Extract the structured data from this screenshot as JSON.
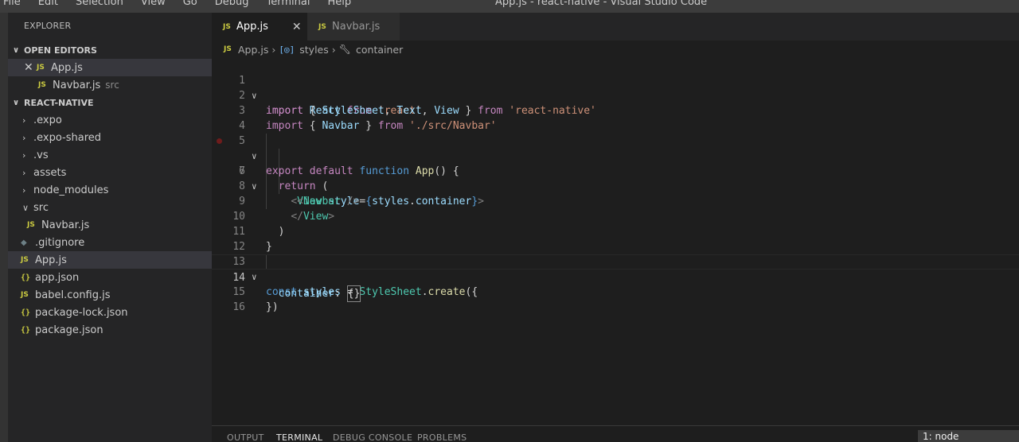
{
  "titlebar": {
    "menu": [
      "File",
      "Edit",
      "Selection",
      "View",
      "Go",
      "Debug",
      "Terminal",
      "Help"
    ],
    "title": "App.js - react-native - Visual Studio Code"
  },
  "sidebar": {
    "title": "EXPLORER",
    "open_editors": {
      "header": "OPEN EDITORS",
      "items": [
        {
          "name": "App.js",
          "badge": "JS"
        },
        {
          "name": "Navbar.js",
          "badge": "JS",
          "path": "src"
        }
      ]
    },
    "project": {
      "header": "REACT-NATIVE",
      "items": [
        {
          "name": ".expo",
          "type": "folder"
        },
        {
          "name": ".expo-shared",
          "type": "folder"
        },
        {
          "name": ".vs",
          "type": "folder"
        },
        {
          "name": "assets",
          "type": "folder"
        },
        {
          "name": "node_modules",
          "type": "folder"
        },
        {
          "name": "src",
          "type": "folder-open"
        },
        {
          "name": "Navbar.js",
          "type": "js"
        },
        {
          "name": ".gitignore",
          "type": "git"
        },
        {
          "name": "App.js",
          "type": "js"
        },
        {
          "name": "app.json",
          "type": "json"
        },
        {
          "name": "babel.config.js",
          "type": "js"
        },
        {
          "name": "package-lock.json",
          "type": "json"
        },
        {
          "name": "package.json",
          "type": "json"
        }
      ]
    },
    "badges": {
      "js": "JS",
      "json": "{}",
      "git": "◆"
    }
  },
  "tabs": [
    {
      "label": "App.js",
      "badge": "JS",
      "active": true
    },
    {
      "label": "Navbar.js",
      "badge": "JS",
      "active": false
    }
  ],
  "breadcrumb": {
    "file": "App.js",
    "file_badge": "JS",
    "obj_icon": "[◎]",
    "obj": "styles",
    "prop": "container"
  },
  "editor": {
    "line_numbers": [
      "1",
      "2",
      "3",
      "4",
      "5",
      "6",
      "7",
      "8",
      "9",
      "10",
      "11",
      "12",
      "13",
      "14",
      "15",
      "16"
    ],
    "current_line": 14,
    "breakpoint_line": 6
  },
  "panel": {
    "tabs": [
      "OUTPUT",
      "TERMINAL",
      "DEBUG CONSOLE",
      "PROBLEMS"
    ],
    "active_tab": "TERMINAL",
    "terminal_select": "1: node"
  },
  "colors": {
    "keyword": "#c586c0",
    "storage": "#569cd6",
    "variable": "#9cdcfe",
    "type": "#4ec9b0",
    "string": "#ce9178",
    "function": "#dcdcaa",
    "js_icon": "#cbcb41"
  }
}
